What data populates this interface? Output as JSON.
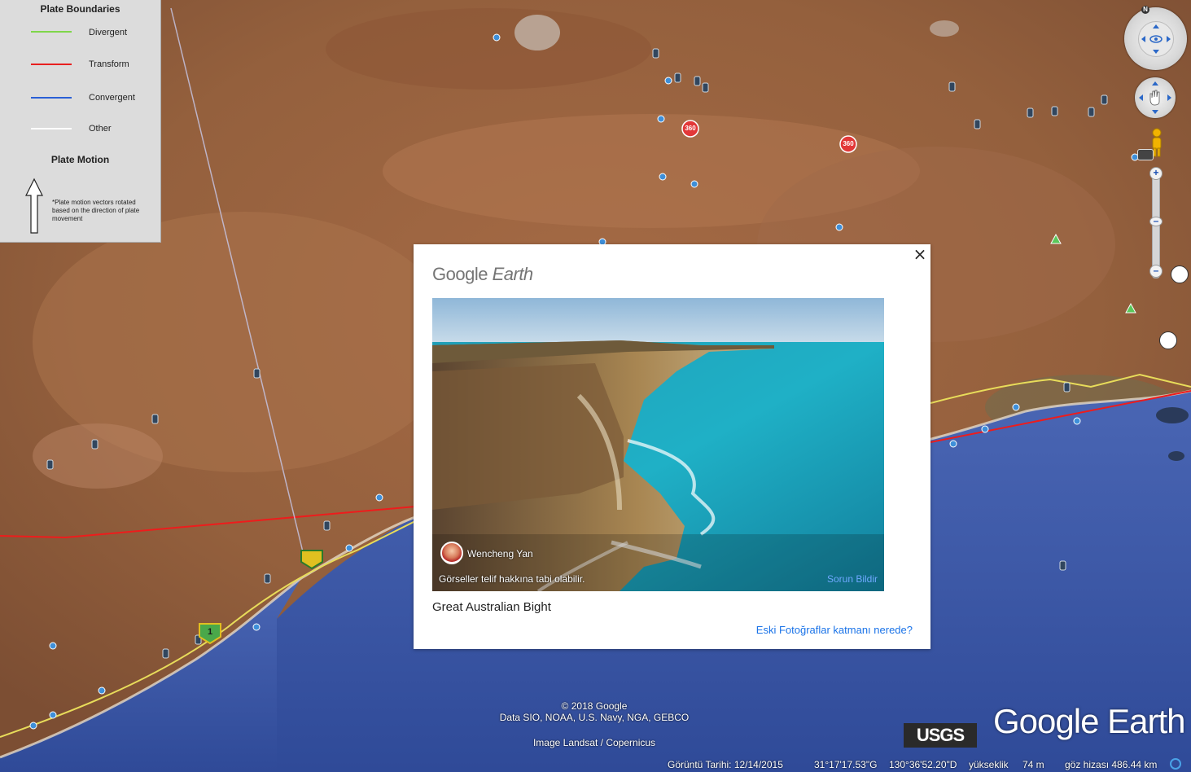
{
  "legend": {
    "title": "Plate Boundaries",
    "items": [
      {
        "label": "Divergent",
        "color": "#7fd64a"
      },
      {
        "label": "Transform",
        "color": "#e82020"
      },
      {
        "label": "Convergent",
        "color": "#2a5fd6"
      },
      {
        "label": "Other",
        "color": "#ffffff"
      }
    ],
    "motion_title": "Plate Motion",
    "motion_note": "*Plate motion vectors rotated based on the direction of plate movement"
  },
  "popup": {
    "logo_google": "Google",
    "logo_earth": "Earth",
    "close_symbol": "×",
    "author": "Wencheng Yan",
    "copyright_note": "Görseller telif hakkına tabi olabilir.",
    "report_link": "Sorun Bildir",
    "place_title": "Great Australian Bight",
    "layer_link": "Eski Fotoğraflar katmanı nerede?"
  },
  "map": {
    "badge_360": "360",
    "route_shield_1": "1",
    "compass_north": "N"
  },
  "attribution": {
    "copyright": "© 2018 Google",
    "data": "Data SIO, NOAA, U.S. Navy, NGA, GEBCO",
    "imagery": "Image Landsat / Copernicus",
    "usgs": "USGS",
    "watermark": "Google Earth"
  },
  "status": {
    "date": "Görüntü Tarihi: 12/14/2015",
    "lat": "31°17'17.53\"G",
    "lon": "130°36'52.20\"D",
    "elev_label": "yükseklik",
    "elev_value": "74 m",
    "eye_alt": "göz hizası 486.44 km"
  },
  "colors": {
    "land": "#9a6040",
    "ocean": "#3d5aa8",
    "link": "#1a73e8"
  }
}
